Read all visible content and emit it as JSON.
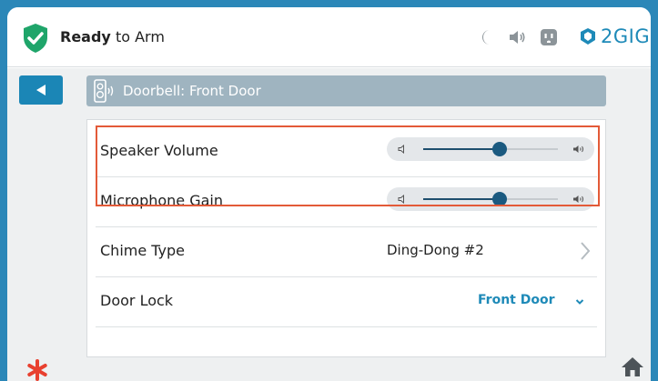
{
  "header": {
    "status_bold": "Ready",
    "status_rest": " to Arm",
    "brand": "2GIG",
    "icons": [
      "shield-check-icon",
      "moon-icon",
      "speaker-icon",
      "outlet-icon",
      "brand-logo-icon"
    ]
  },
  "nav": {
    "back_icon": "back-arrow-icon",
    "title": "Doorbell: Front Door",
    "title_icon": "doorbell-icon"
  },
  "settings": {
    "speaker_volume": {
      "label": "Speaker Volume",
      "level": 0.57
    },
    "microphone_gain": {
      "label": "Microphone Gain",
      "level": 0.57
    },
    "chime_type": {
      "label": "Chime Type",
      "value": "Ding-Dong #2"
    },
    "door_lock": {
      "label": "Door Lock",
      "value": "Front Door"
    }
  },
  "footer": {
    "left_icon": "asterisk-icon",
    "right_icon": "home-icon"
  },
  "colors": {
    "accent": "#1e8ab8",
    "shield": "#1fa56a",
    "highlight": "#e35a38",
    "title_bar": "#9fb4c0",
    "frame": "#2b87b8"
  }
}
